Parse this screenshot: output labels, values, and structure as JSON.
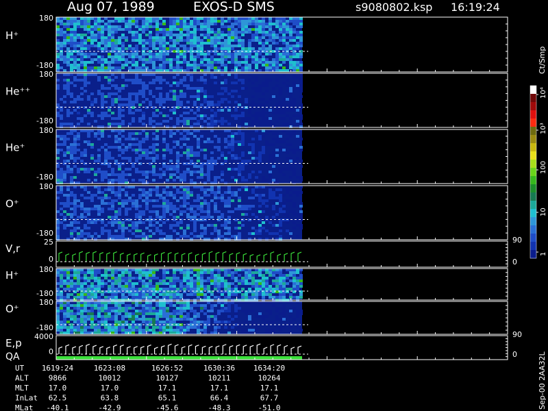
{
  "header": {
    "date": "Aug 07, 1989",
    "instrument": "EXOS-D SMS",
    "file": "s9080802.ksp",
    "time": "16:19:24"
  },
  "colorbar": {
    "unit": "Ct/Smp",
    "tick_labels": [
      "1",
      "10",
      "100",
      "10³",
      "10⁴"
    ],
    "colors": [
      "#0a1c8c",
      "#1133b0",
      "#1f4dc8",
      "#2a6fd6",
      "#2e96d8",
      "#1fbfcf",
      "#1ca99a",
      "#167a52",
      "#1a8e2a",
      "#36b81c",
      "#6ad51a",
      "#a8e01a",
      "#e8e01a",
      "#c9b80f",
      "#9a8a10",
      "#6d6a10",
      "#ff2a10",
      "#e0100e",
      "#a00a0a",
      "#700808",
      "#ffffff"
    ]
  },
  "colors": {
    "background": "#000000",
    "text": "#ffffff",
    "trace_green": "#3adf3a",
    "spectrogram_floor": "#0a1f8a"
  },
  "time_axis": {
    "rows": [
      {
        "label": "UT",
        "values": [
          "1619:24",
          "1623:08",
          "1626:52",
          "1630:36",
          "1634:20"
        ]
      },
      {
        "label": "ALT",
        "values": [
          "9866",
          "10012",
          "10127",
          "10211",
          "10264"
        ]
      },
      {
        "label": "MLT",
        "values": [
          "17.0",
          "17.0",
          "17.1",
          "17.1",
          "17.1"
        ]
      },
      {
        "label": "InLat",
        "values": [
          "62.5",
          "63.8",
          "65.1",
          "66.4",
          "67.7"
        ]
      },
      {
        "label": "MLat",
        "values": [
          "-40.1",
          "-42.9",
          "-45.6",
          "-48.3",
          "-51.0"
        ]
      }
    ]
  },
  "footer_text": "Sep-00 2AA32L",
  "chart_data": {
    "type": "heatmap",
    "x_ticks": [
      "1619:24",
      "1623:08",
      "1626:52",
      "1630:36",
      "1634:20"
    ],
    "panels": [
      {
        "label": "H⁺",
        "ymax": "180",
        "ymin": "-180",
        "type": "heatmap",
        "intensity_top": 0.45,
        "fade_start": 1.0
      },
      {
        "label": "He⁺⁺",
        "ymax": "180",
        "ymin": "-180",
        "type": "heatmap",
        "intensity_top": 0.22,
        "fade_start": 0.55
      },
      {
        "label": "He⁺",
        "ymax": "180",
        "ymin": "-180",
        "type": "heatmap",
        "intensity_top": 0.24,
        "fade_start": 0.62
      },
      {
        "label": "O⁺",
        "ymax": "180",
        "ymin": "-180",
        "type": "heatmap",
        "intensity_top": 0.26,
        "fade_start": 0.7
      },
      {
        "label": "V,r",
        "ymax": "25",
        "ymin": "0",
        "right_ticks": [
          "90",
          "0"
        ],
        "type": "trace"
      },
      {
        "label": "H⁺",
        "ymax": "180",
        "ymin": "-180",
        "type": "heatmap",
        "intensity_top": 0.5,
        "fade_start": 1.0
      },
      {
        "label": "O⁺",
        "ymax": "180",
        "ymin": "-180",
        "type": "heatmap",
        "intensity_top": 0.55,
        "fade_start": 0.45
      },
      {
        "label": "E,p",
        "label2": "QA",
        "ymax": "4000",
        "ymin": "0",
        "right_ticks": [
          "90",
          "0"
        ],
        "type": "trace"
      }
    ]
  }
}
